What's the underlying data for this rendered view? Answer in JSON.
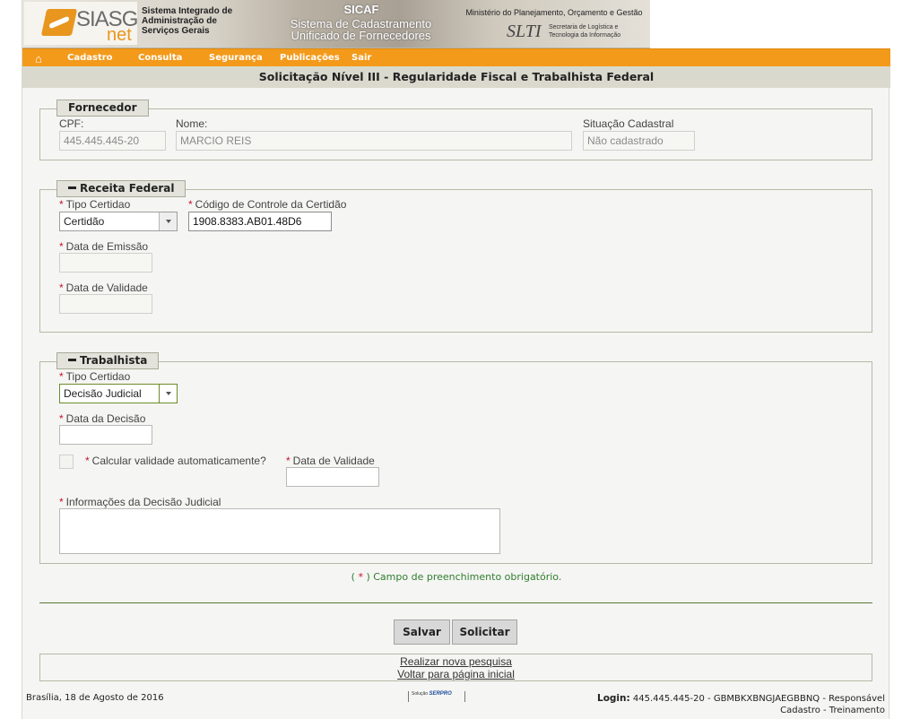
{
  "banner": {
    "logo_text": "SIASG",
    "logo_net": "net",
    "system_name_line1": "Sistema Integrado de",
    "system_name_line2": "Administração de",
    "system_name_line3": "Serviços Gerais",
    "sicaf_title": "SICAF",
    "sicaf_sub_line1": "Sistema de Cadastramento",
    "sicaf_sub_line2": "Unificado de Fornecedores",
    "ministry": "Ministério do Planejamento, Orçamento e Gestão",
    "slti_logo": "SLTI",
    "slti_text_line1": "Secretaria de Logística e",
    "slti_text_line2": "Tecnologia da Informação"
  },
  "menu": {
    "home_icon": "home-icon",
    "items": [
      "Cadastro",
      "Consulta",
      "Segurança",
      "Publicações",
      "Sair"
    ]
  },
  "page_title": "Solicitação Nível III - Regularidade Fiscal e Trabalhista Federal",
  "fornecedor": {
    "legend": "Fornecedor",
    "cpf_label": "CPF:",
    "cpf_value": "445.445.445-20",
    "nome_label": "Nome:",
    "nome_value": "MARCIO REIS",
    "situacao_label": "Situação Cadastral",
    "situacao_value": "Não cadastrado"
  },
  "receita": {
    "legend": "Receita Federal",
    "tipo_label": "Tipo Certidao",
    "tipo_value": "Certidão",
    "codigo_label": "Código de Controle da Certidão",
    "codigo_value": "1908.8383.AB01.48D6",
    "emissao_label": "Data de Emissão",
    "emissao_value": "",
    "validade_label": "Data de Validade",
    "validade_value": ""
  },
  "trabalhista": {
    "legend": "Trabalhista",
    "tipo_label": "Tipo Certidao",
    "tipo_value": "Decisão Judicial",
    "decisao_label": "Data da Decisão",
    "decisao_value": "",
    "calcular_label": "Calcular validade automaticamente?",
    "calcular_checked": false,
    "validade_label": "Data de Validade",
    "validade_value": "",
    "info_label": "Informações da Decisão Judicial",
    "info_value": ""
  },
  "required_star": "*",
  "note": {
    "open": "( ",
    "star": "*",
    "close": " ) Campo de preenchimento obrigatório."
  },
  "buttons": {
    "salvar": "Salvar",
    "solicitar": "Solicitar"
  },
  "links": {
    "nova_pesquisa": "Realizar nova pesquisa",
    "voltar": "Voltar para página inicial"
  },
  "footer": {
    "location_date": "Brasília, 18 de Agosto de 2016",
    "solucao": "Solução",
    "serpro": "SERPRO",
    "login_label": "Login:",
    "login_value": "445.445.445-20 - GBMBKXBNGJAEGBBNQ - Responsável",
    "login_line2": "Cadastro - Treinamento"
  }
}
